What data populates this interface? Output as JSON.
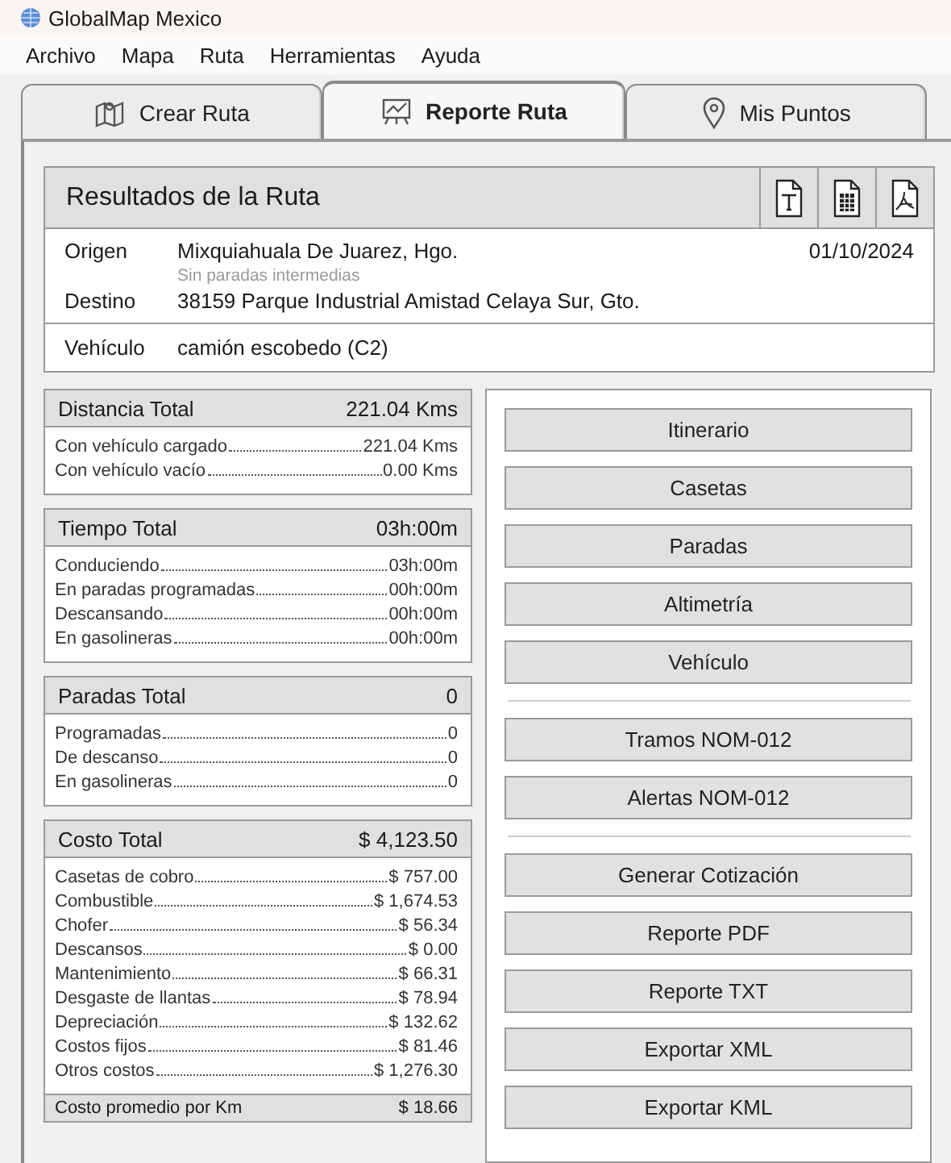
{
  "window": {
    "title": "GlobalMap Mexico"
  },
  "menu": [
    "Archivo",
    "Mapa",
    "Ruta",
    "Herramientas",
    "Ayuda"
  ],
  "tabs": [
    {
      "label": "Crear Ruta",
      "kind": "map",
      "selected": false
    },
    {
      "label": "Reporte Ruta",
      "kind": "chart",
      "selected": true
    },
    {
      "label": "Mis Puntos",
      "kind": "pin",
      "selected": false
    }
  ],
  "results": {
    "title": "Resultados de la Ruta",
    "export_buttons": [
      {
        "kind": "txt"
      },
      {
        "kind": "xls"
      },
      {
        "kind": "pdf"
      }
    ],
    "origin_label": "Origen",
    "origin": "Mixquiahuala De Juarez, Hgo.",
    "date": "01/10/2024",
    "stops_note": "Sin paradas intermedias",
    "destination_label": "Destino",
    "destination": "38159 Parque Industrial Amistad Celaya Sur, Gto.",
    "vehicle_label": "Vehículo",
    "vehicle": "camión escobedo (C2)"
  },
  "summaries": [
    {
      "label": "Distancia Total",
      "value": "221.04 Kms",
      "rows": [
        {
          "label": "Con vehículo cargado",
          "value": "221.04 Kms"
        },
        {
          "label": "Con vehículo vacío",
          "value": "0.00 Kms"
        }
      ]
    },
    {
      "label": "Tiempo Total",
      "value": "03h:00m",
      "rows": [
        {
          "label": "Conduciendo",
          "value": "03h:00m"
        },
        {
          "label": "En paradas programadas",
          "value": "00h:00m"
        },
        {
          "label": "Descansando",
          "value": "00h:00m"
        },
        {
          "label": "En gasolineras",
          "value": "00h:00m"
        }
      ]
    },
    {
      "label": "Paradas Total",
      "value": "0",
      "rows": [
        {
          "label": "Programadas",
          "value": "0"
        },
        {
          "label": "De descanso",
          "value": "0"
        },
        {
          "label": "En gasolineras",
          "value": "0"
        }
      ]
    },
    {
      "label": "Costo Total",
      "value": "$ 4,123.50",
      "rows": [
        {
          "label": "Casetas de cobro",
          "value": "$ 757.00"
        },
        {
          "label": "Combustible",
          "value": "$ 1,674.53"
        },
        {
          "label": "Chofer",
          "value": "$ 56.34"
        },
        {
          "label": "Descansos",
          "value": "$ 0.00"
        },
        {
          "label": "Mantenimiento",
          "value": "$ 66.31"
        },
        {
          "label": "Desgaste de llantas",
          "value": "$ 78.94"
        },
        {
          "label": "Depreciación",
          "value": "$ 132.62"
        },
        {
          "label": "Costos fijos",
          "value": "$ 81.46"
        },
        {
          "label": "Otros costos",
          "value": "$ 1,276.30"
        }
      ],
      "footer": {
        "label": "Costo promedio por Km",
        "value": "$ 18.66"
      }
    }
  ],
  "button_groups": [
    [
      "Itinerario",
      "Casetas",
      "Paradas",
      "Altimetría",
      "Vehículo"
    ],
    [
      "Tramos NOM-012",
      "Alertas NOM-012"
    ],
    [
      "Generar Cotización",
      "Reporte PDF",
      "Reporte TXT",
      "Exportar XML",
      "Exportar KML"
    ]
  ]
}
